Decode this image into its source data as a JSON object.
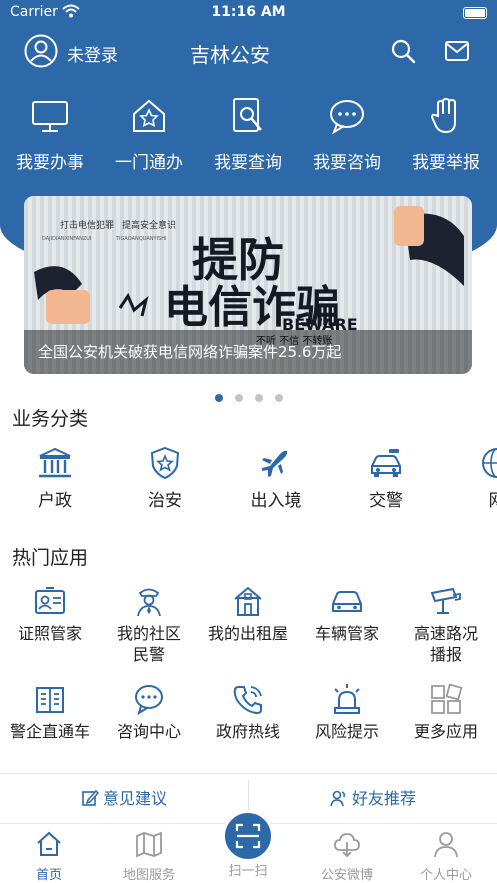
{
  "status_bar": {
    "carrier": "Carrier",
    "time": "11:16 AM"
  },
  "header": {
    "login_text": "未登录",
    "title": "吉林公安"
  },
  "quick_actions": [
    {
      "label": "我要办事",
      "icon": "monitor-icon"
    },
    {
      "label": "一门通办",
      "icon": "house-star-icon"
    },
    {
      "label": "我要查询",
      "icon": "search-doc-icon"
    },
    {
      "label": "我要咨询",
      "icon": "chat-bubble-icon"
    },
    {
      "label": "我要举报",
      "icon": "hand-icon"
    }
  ],
  "banner": {
    "caption": "全国公安机关破获电信网络诈骗案件25.6万起",
    "art_top_line_1": "打击电信犯罪",
    "art_top_line_2": "提高安全意识",
    "art_pinyin_1": "DAJIDIANXINFANZUI",
    "art_pinyin_2": "TIGAOANQUANYISHI",
    "art_headline_1": "提防",
    "art_headline_2": "电信诈骗",
    "art_beware": "BEWARE",
    "art_slogan": "不听 不信 不转账"
  },
  "carousel": {
    "count": 4,
    "active_index": 0
  },
  "business_section": {
    "title": "业务分类",
    "items": [
      {
        "label": "户政",
        "icon": "government-building-icon"
      },
      {
        "label": "治安",
        "icon": "police-badge-icon"
      },
      {
        "label": "出入境",
        "icon": "airplane-icon"
      },
      {
        "label": "交警",
        "icon": "police-car-icon"
      },
      {
        "label": "网",
        "icon": "globe-shield-icon"
      }
    ]
  },
  "hot_apps_section": {
    "title": "热门应用",
    "row1": [
      {
        "label_line1": "证照管家",
        "label_line2": "",
        "icon": "id-card-icon"
      },
      {
        "label_line1": "我的社区",
        "label_line2": "民警",
        "icon": "police-officer-icon"
      },
      {
        "label_line1": "我的出租屋",
        "label_line2": "",
        "icon": "rental-house-icon"
      },
      {
        "label_line1": "车辆管家",
        "label_line2": "",
        "icon": "car-icon"
      },
      {
        "label_line1": "高速路况",
        "label_line2": "播报",
        "icon": "cctv-camera-icon"
      }
    ],
    "row2": [
      {
        "label": "警企直通车",
        "icon": "building-icon"
      },
      {
        "label": "咨询中心",
        "icon": "chat-icon"
      },
      {
        "label": "政府热线",
        "icon": "phone-icon"
      },
      {
        "label": "风险提示",
        "icon": "alarm-light-icon"
      },
      {
        "label": "更多应用",
        "icon": "grid-icon"
      }
    ]
  },
  "bottom_actions": {
    "feedback": "意见建议",
    "recommend": "好友推荐"
  },
  "tabbar": [
    {
      "label": "首页",
      "icon": "home-icon"
    },
    {
      "label": "地图服务",
      "icon": "map-icon"
    },
    {
      "label": "扫一扫",
      "icon": "scan-icon"
    },
    {
      "label": "公安微博",
      "icon": "cloud-icon"
    },
    {
      "label": "个人中心",
      "icon": "user-icon"
    }
  ],
  "colors": {
    "brand_blue": "#2d68a9",
    "icon_blue": "#2d68a9",
    "inactive_gray": "#9a9a9a"
  }
}
